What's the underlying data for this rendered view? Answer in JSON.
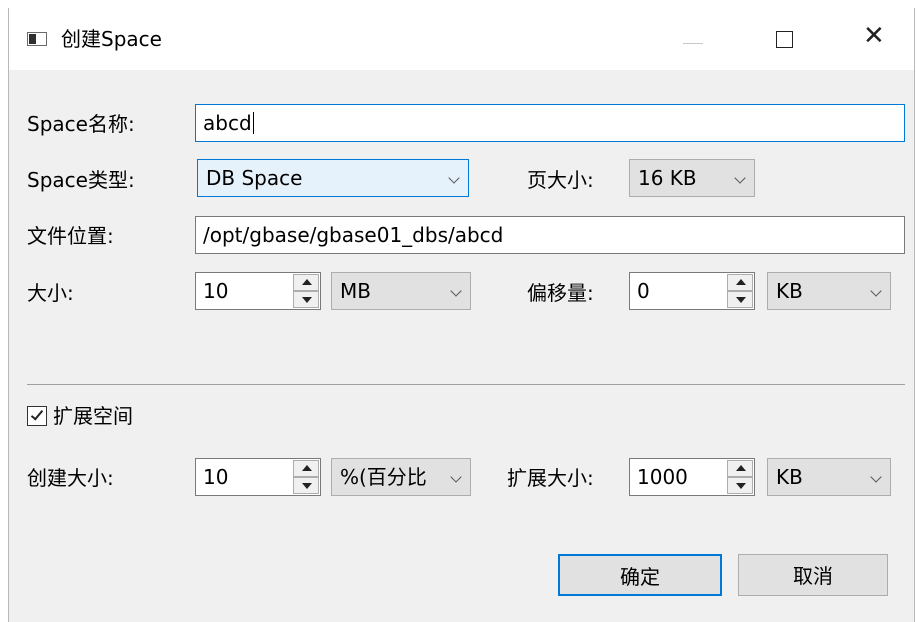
{
  "window": {
    "title": "创建Space",
    "icon": "window-app-icon",
    "controls": [
      "minimize-icon",
      "maximize-icon",
      "close-icon"
    ],
    "close_glyph": "✕"
  },
  "form": {
    "name_label": "Space名称:",
    "name_value": "abcd",
    "type_label": "Space类型:",
    "type_value": "DB Space",
    "page_size_label": "页大小:",
    "page_size_value": "16 KB",
    "location_label": "文件位置:",
    "location_value": "/opt/gbase/gbase01_dbs/abcd",
    "size_label": "大小:",
    "size_value": "10",
    "size_unit": "MB",
    "offset_label": "偏移量:",
    "offset_value": "0",
    "offset_unit": "KB"
  },
  "expand": {
    "checkbox_label": "扩展空间",
    "checked": true,
    "create_size_label": "创建大小:",
    "create_size_value": "10",
    "create_size_unit": "%(百分比",
    "expand_size_label": "扩展大小:",
    "expand_size_value": "1000",
    "expand_size_unit": "KB"
  },
  "buttons": {
    "ok_label": "确定",
    "cancel_label": "取消"
  },
  "colors": {
    "accent": "#0078d7",
    "dialog_bg": "#f0f0f0",
    "button_bg": "#e1e1e1"
  }
}
